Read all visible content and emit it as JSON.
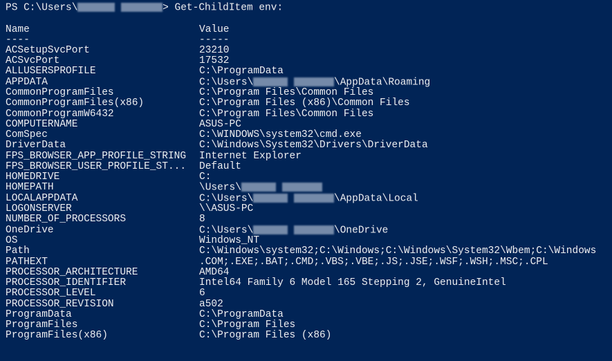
{
  "prompt": {
    "prefix": "PS C:\\Users\\",
    "suffix": ">",
    "command": "Get-ChildItem env:"
  },
  "headers": {
    "name": "Name",
    "value": "Value"
  },
  "dividers": {
    "name": "----",
    "value": "-----"
  },
  "entries": [
    {
      "name": "ACSetupSvcPort",
      "value": "23210"
    },
    {
      "name": "ACSvcPort",
      "value": "17532"
    },
    {
      "name": "ALLUSERSPROFILE",
      "value": "C:\\ProgramData"
    },
    {
      "name": "APPDATA",
      "valuePrefix": "C:\\Users\\",
      "redacted": true,
      "valueSuffix": "\\AppData\\Roaming"
    },
    {
      "name": "CommonProgramFiles",
      "value": "C:\\Program Files\\Common Files"
    },
    {
      "name": "CommonProgramFiles(x86)",
      "value": "C:\\Program Files (x86)\\Common Files"
    },
    {
      "name": "CommonProgramW6432",
      "value": "C:\\Program Files\\Common Files"
    },
    {
      "name": "COMPUTERNAME",
      "value": "ASUS-PC"
    },
    {
      "name": "ComSpec",
      "value": "C:\\WINDOWS\\system32\\cmd.exe"
    },
    {
      "name": "DriverData",
      "value": "C:\\Windows\\System32\\Drivers\\DriverData"
    },
    {
      "name": "FPS_BROWSER_APP_PROFILE_STRING",
      "value": "Internet Explorer"
    },
    {
      "name": "FPS_BROWSER_USER_PROFILE_ST...",
      "value": "Default"
    },
    {
      "name": "HOMEDRIVE",
      "value": "C:"
    },
    {
      "name": "HOMEPATH",
      "valuePrefix": "\\Users\\",
      "redacted": true,
      "valueSuffix": ""
    },
    {
      "name": "LOCALAPPDATA",
      "valuePrefix": "C:\\Users\\",
      "redacted": true,
      "valueSuffix": "\\AppData\\Local"
    },
    {
      "name": "LOGONSERVER",
      "value": "\\\\ASUS-PC"
    },
    {
      "name": "NUMBER_OF_PROCESSORS",
      "value": "8"
    },
    {
      "name": "OneDrive",
      "valuePrefix": "C:\\Users\\",
      "redacted": true,
      "valueSuffix": "\\OneDrive"
    },
    {
      "name": "OS",
      "value": "Windows_NT"
    },
    {
      "name": "Path",
      "value": "C:\\Windows\\system32;C:\\Windows;C:\\Windows\\System32\\Wbem;C:\\Windows"
    },
    {
      "name": "PATHEXT",
      "value": ".COM;.EXE;.BAT;.CMD;.VBS;.VBE;.JS;.JSE;.WSF;.WSH;.MSC;.CPL"
    },
    {
      "name": "PROCESSOR_ARCHITECTURE",
      "value": "AMD64"
    },
    {
      "name": "PROCESSOR_IDENTIFIER",
      "value": "Intel64 Family 6 Model 165 Stepping 2, GenuineIntel"
    },
    {
      "name": "PROCESSOR_LEVEL",
      "value": "6"
    },
    {
      "name": "PROCESSOR_REVISION",
      "value": "a502"
    },
    {
      "name": "ProgramData",
      "value": "C:\\ProgramData"
    },
    {
      "name": "ProgramFiles",
      "value": "C:\\Program Files"
    },
    {
      "name": "ProgramFiles(x86)",
      "value": "C:\\Program Files (x86)"
    }
  ]
}
